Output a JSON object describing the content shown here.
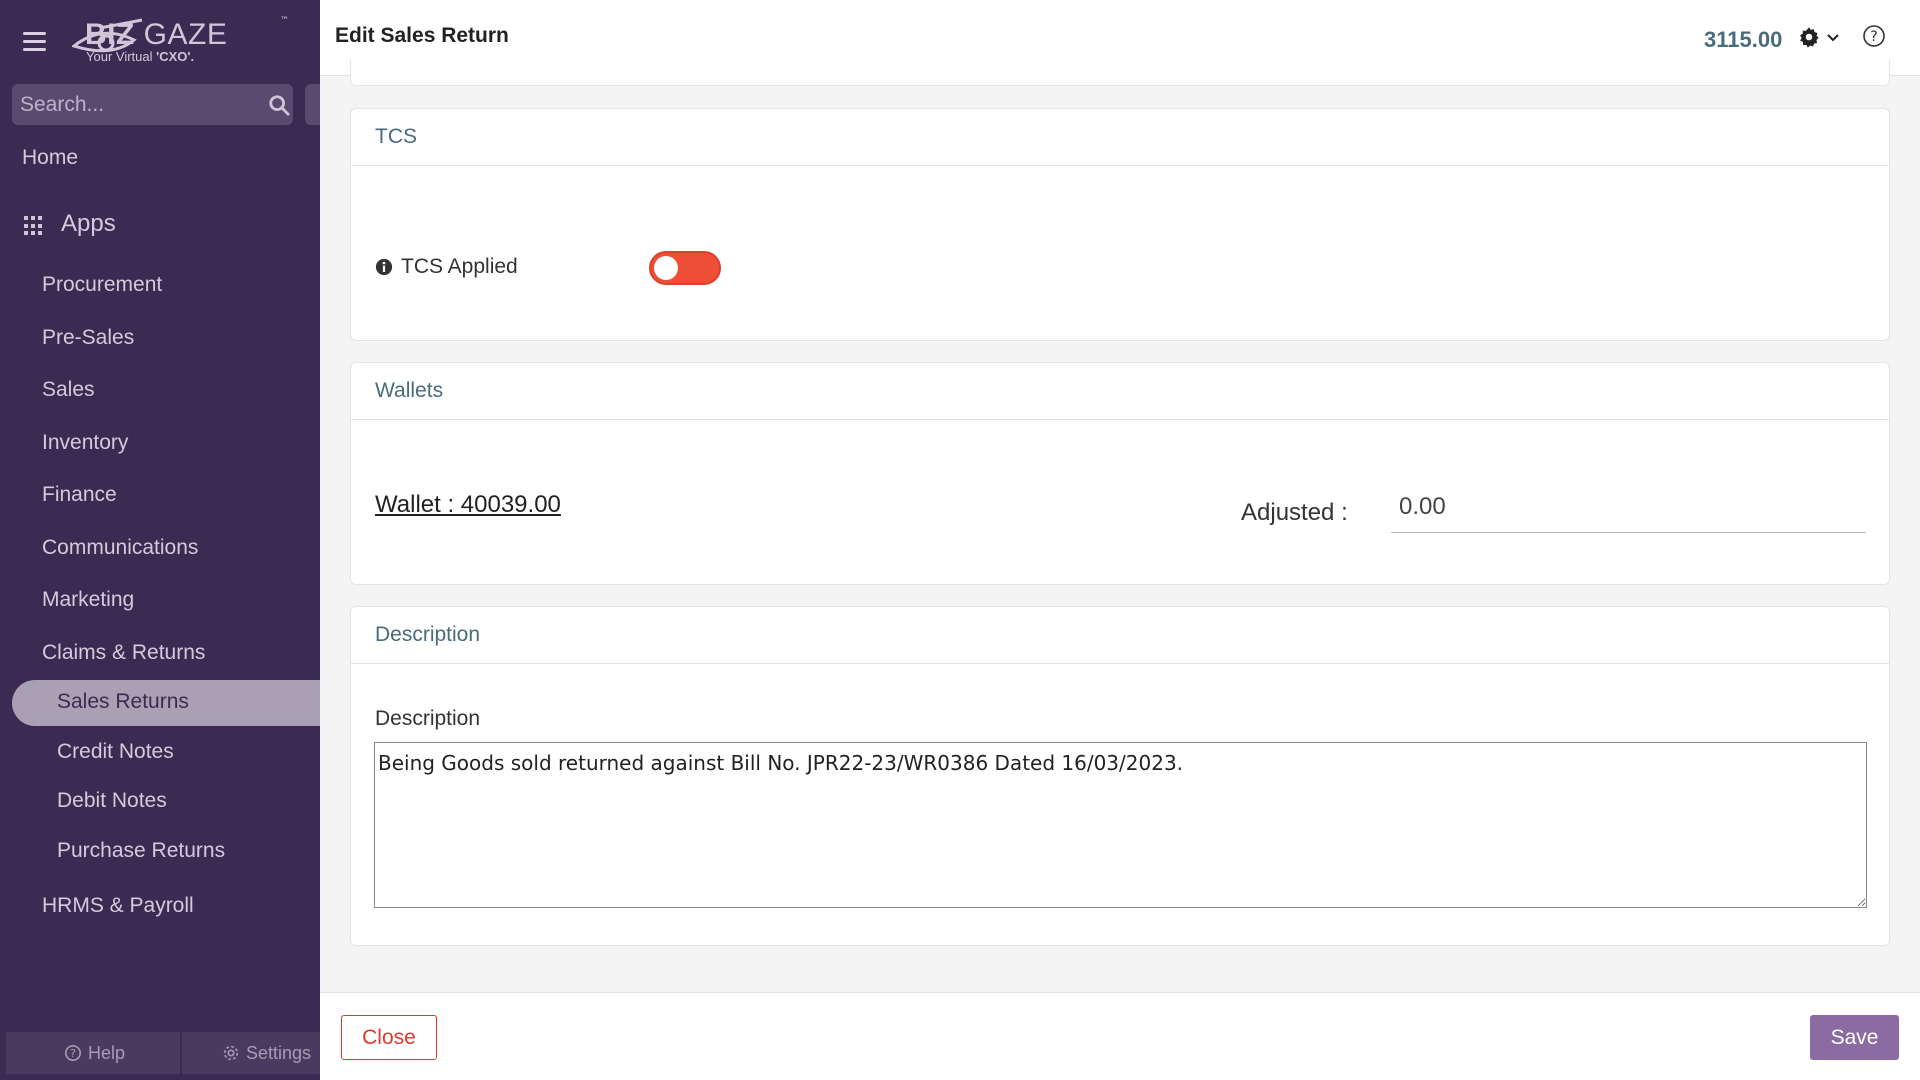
{
  "sidebar": {
    "logo": {
      "brand": "BIZ GAZE",
      "brand_bold": "BIZ",
      "brand_light": "GAZE",
      "tagline_prefix": "Your Virtual ",
      "tagline_bold": "'CXO'.",
      "trademark": "™"
    },
    "search": {
      "placeholder": "Search..."
    },
    "home": "Home",
    "apps": "Apps",
    "items": [
      {
        "label": "Procurement"
      },
      {
        "label": "Pre-Sales"
      },
      {
        "label": "Sales"
      },
      {
        "label": "Inventory"
      },
      {
        "label": "Finance"
      },
      {
        "label": "Communications"
      },
      {
        "label": "Marketing"
      },
      {
        "label": "Claims & Returns"
      }
    ],
    "subitems": [
      {
        "label": "Sales Returns",
        "active": true
      },
      {
        "label": "Credit Notes"
      },
      {
        "label": "Debit Notes"
      },
      {
        "label": "Purchase Returns"
      }
    ],
    "last_item": "HRMS & Payroll",
    "footer": {
      "help": "Help",
      "settings": "Settings"
    }
  },
  "header": {
    "title": "Edit Sales Return",
    "total": "3115.00"
  },
  "tcs": {
    "heading": "TCS",
    "label": "TCS Applied",
    "applied": false
  },
  "wallets": {
    "heading": "Wallets",
    "wallet_text": "Wallet : 40039.00",
    "adjusted_label": "Adjusted :",
    "adjusted_value": "0.00"
  },
  "description": {
    "heading": "Description",
    "label": "Description",
    "value": "Being Goods sold returned against Bill No. JPR22-23/WR0386 Dated 16/03/2023."
  },
  "footer": {
    "close_label": "Close",
    "save_label": "Save"
  },
  "colors": {
    "sidebar_bg": "#3d2a52",
    "accent": "#8c6ba3",
    "toggle_off": "#ef4d35",
    "heading": "#4a6b7c"
  }
}
